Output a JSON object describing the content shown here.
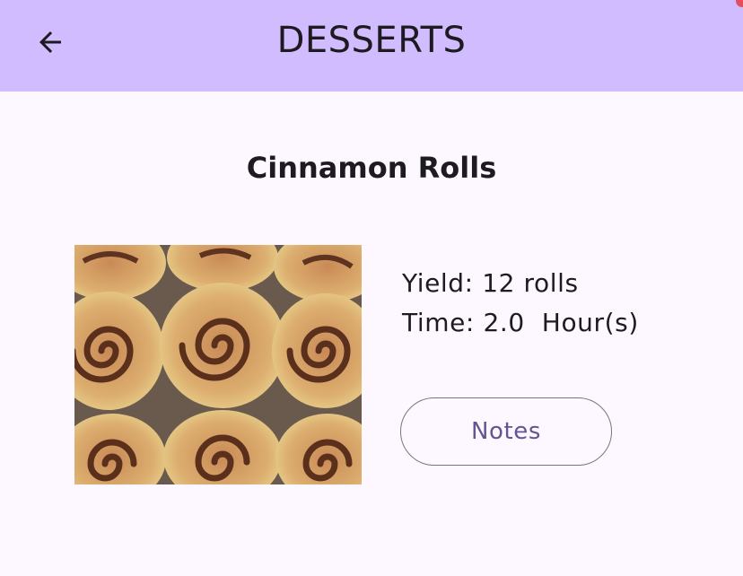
{
  "app_bar": {
    "title": "DESSERTS",
    "back_icon": "arrow-back-icon",
    "background": "#d0bcff"
  },
  "recipe": {
    "name": "Cinnamon Rolls",
    "yield_text": "Yield: 12 rolls",
    "time_text": "Time: 2.0  Hour(s)",
    "notes_label": "Notes"
  },
  "colors": {
    "page_background": "#fdf7ff",
    "button_text": "#65558f",
    "button_border": "#79747e"
  }
}
